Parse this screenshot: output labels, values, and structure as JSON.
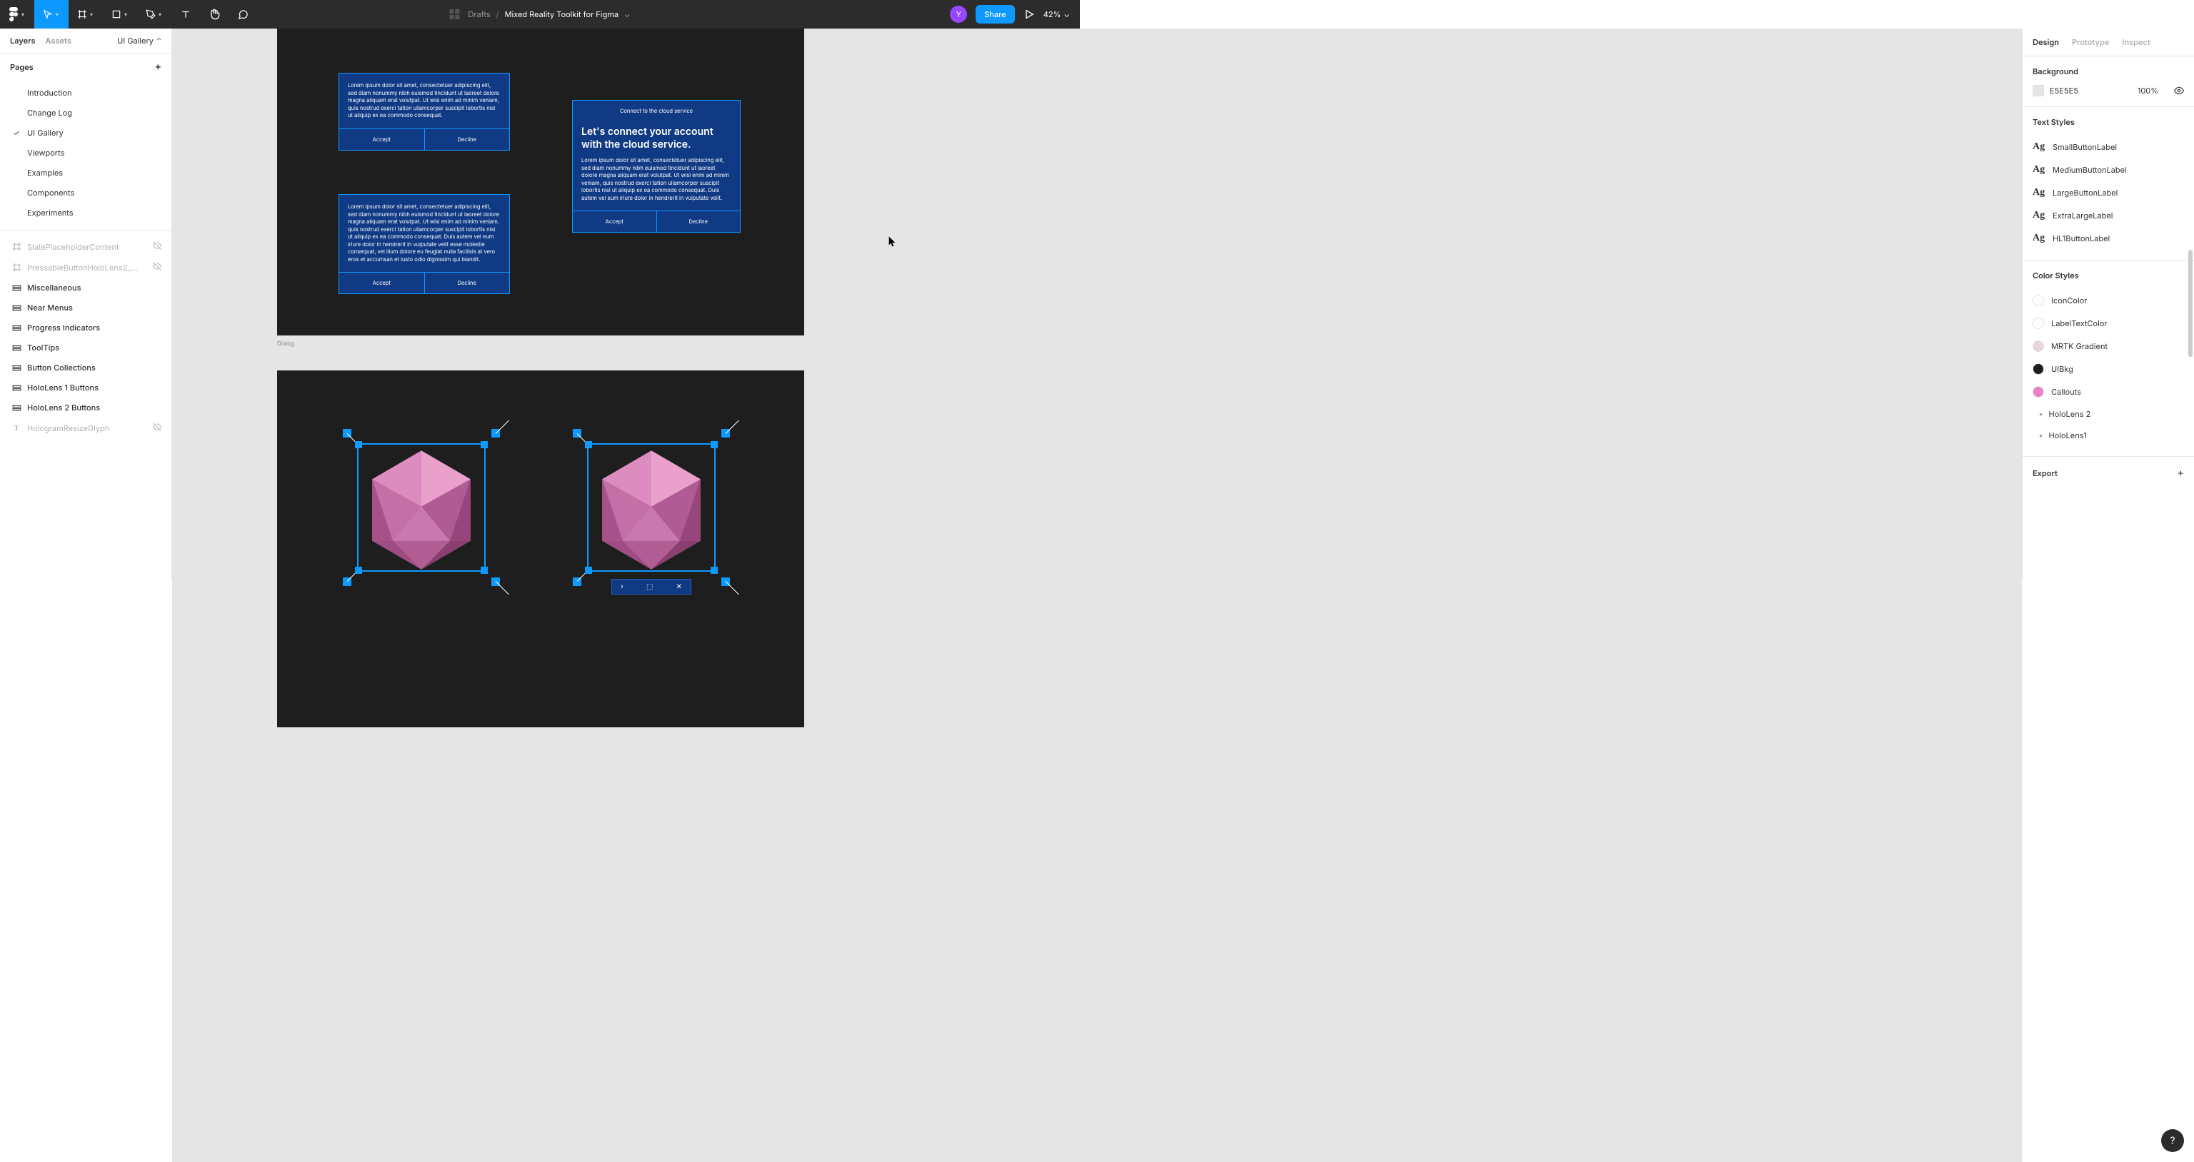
{
  "header": {
    "drafts": "Drafts",
    "title": "Mixed Reality Toolkit for Figma",
    "avatar": "Y",
    "share": "Share",
    "zoom": "42%"
  },
  "left": {
    "tab_layers": "Layers",
    "tab_assets": "Assets",
    "page_selector": "UI Gallery",
    "pages_label": "Pages",
    "pages": [
      {
        "label": "Introduction",
        "active": false
      },
      {
        "label": "Change Log",
        "active": false
      },
      {
        "label": "UI Gallery",
        "active": true
      },
      {
        "label": "Viewports",
        "active": false
      },
      {
        "label": "Examples",
        "active": false
      },
      {
        "label": "Components",
        "active": false
      },
      {
        "label": "Experiments",
        "active": false
      }
    ],
    "layers": [
      {
        "label": "SlatePlaceholderContent",
        "icon": "#",
        "dim": true,
        "eye": true
      },
      {
        "label": "PressableButtonHoloLens2_...",
        "icon": "#",
        "dim": true,
        "eye": true
      },
      {
        "label": "Miscellaneous",
        "icon": "frame",
        "dim": false
      },
      {
        "label": "Near Menus",
        "icon": "frame",
        "dim": false
      },
      {
        "label": "Progress Indicators",
        "icon": "frame",
        "dim": false
      },
      {
        "label": "ToolTips",
        "icon": "frame",
        "dim": false
      },
      {
        "label": "Button Collections",
        "icon": "frame",
        "dim": false
      },
      {
        "label": "HoloLens 1 Buttons",
        "icon": "frame",
        "dim": false
      },
      {
        "label": "HoloLens 2 Buttons",
        "icon": "frame",
        "dim": false
      },
      {
        "label": "HologramResizeGlyph",
        "icon": "T",
        "dim": true,
        "eye": true
      }
    ]
  },
  "right": {
    "tab_design": "Design",
    "tab_prototype": "Prototype",
    "tab_inspect": "Inspect",
    "background_label": "Background",
    "bg_hex": "E5E5E5",
    "bg_pct": "100%",
    "text_styles_label": "Text Styles",
    "text_styles": [
      {
        "label": "SmallButtonLabel"
      },
      {
        "label": "MediumButtonLabel"
      },
      {
        "label": "LargeButtonLabel"
      },
      {
        "label": "ExtraLargeLabel"
      },
      {
        "label": "HL1ButtonLabel"
      }
    ],
    "color_styles_label": "Color Styles",
    "color_styles": [
      {
        "label": "IconColor",
        "color": "#ffffff"
      },
      {
        "label": "LabelTextColor",
        "color": "#ffffff"
      },
      {
        "label": "MRTK Gradient",
        "color": "#E9D5E0"
      },
      {
        "label": "UIBkg",
        "color": "#1e1e1e"
      },
      {
        "label": "Callouts",
        "color": "#EA80CC"
      }
    ],
    "color_groups": [
      {
        "label": "HoloLens 2"
      },
      {
        "label": "HoloLens1"
      }
    ],
    "export_label": "Export"
  },
  "canvas": {
    "frame1_label": "Dialog",
    "lorem_short": "Lorem ipsum dolor sit amet, consectetuer adipiscing elit, sed diam nonummy nibh euismod tincidunt ut laoreet dolore magna aliquam erat volutpat. Ut wisi enim ad minim veniam, quis nostrud exerci tation ullamcorper suscipit lobortis nisl ut aliquip ex ea commodo consequat.",
    "lorem_long": "Lorem ipsum dolor sit amet, consectetuer adipiscing elit, sed diam nonummy nibh euismod tincidunt ut laoreet dolore magna aliquam erat volutpat. Ut wisi enim ad minim veniam, quis nostrud exerci tation ullamcorper suscipit lobortis nisl ut aliquip ex ea commodo consequat. Duis autem vel eum iriure dolor in hendrerit in vulputate velit esse molestie consequat, vel illum dolore eu feugiat nulla facilisis at vero eros et accumsan et iusto odio dignissim qui blandit.",
    "lorem_med": "Lorem ipsum dolor sit amet, consectetuer adipiscing elit, sed diam nonummy nibh euismod tincidunt ut laoreet dolore magna aliquam erat volutpat. Ut wisi enim ad minim veniam, quis nostrud exerci tation ullamcorper suscipit lobortis nisl ut aliquip ex ea commodo consequat. Duis autem vel eum iriure dolor in hendrerit in vulputate velit.",
    "cloud_small": "Connect to the cloud service",
    "cloud_title": "Let's connect your account with the cloud service.",
    "accept": "Accept",
    "decline": "Decline"
  }
}
